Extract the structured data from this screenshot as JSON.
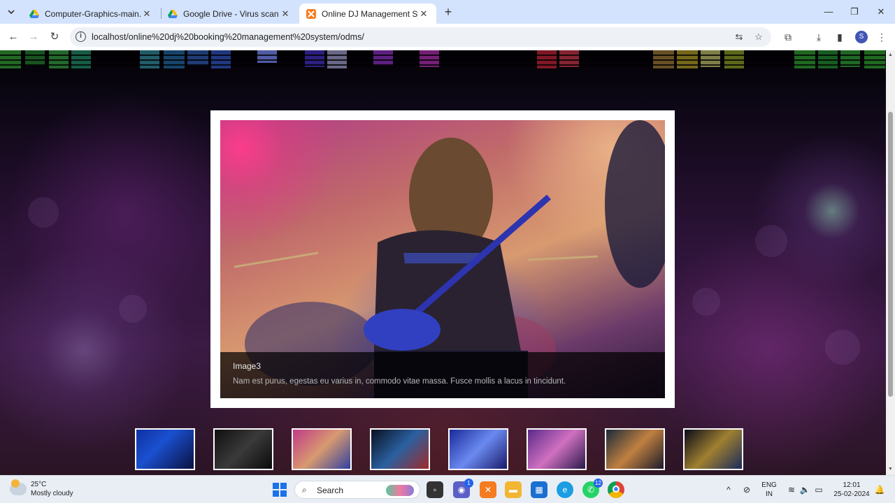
{
  "browser": {
    "tabs": [
      {
        "title": "Computer-Graphics-main.zip - G",
        "active": false
      },
      {
        "title": "Google Drive - Virus scan warn",
        "active": false
      },
      {
        "title": "Online DJ Management System",
        "active": true
      }
    ],
    "url": "localhost/online%20dj%20booking%20management%20system/odms/",
    "profile_initial": "S"
  },
  "slider": {
    "current_title": "Image3",
    "current_text": "Nam est purus, egestas eu varius in, commodo vitae massa. Fusce mollis a lacus in tincidunt.",
    "thumbnail_count": 8
  },
  "taskbar": {
    "weather_temp": "25°C",
    "weather_desc": "Mostly cloudy",
    "search_label": "Search",
    "teams_badge": "1",
    "whatsapp_badge": "12",
    "lang_top": "ENG",
    "lang_bottom": "IN",
    "time": "12:01",
    "date": "25-02-2024"
  },
  "colors": {
    "tabbar": "#d3e3fd",
    "accent_blue": "#2563eb"
  }
}
